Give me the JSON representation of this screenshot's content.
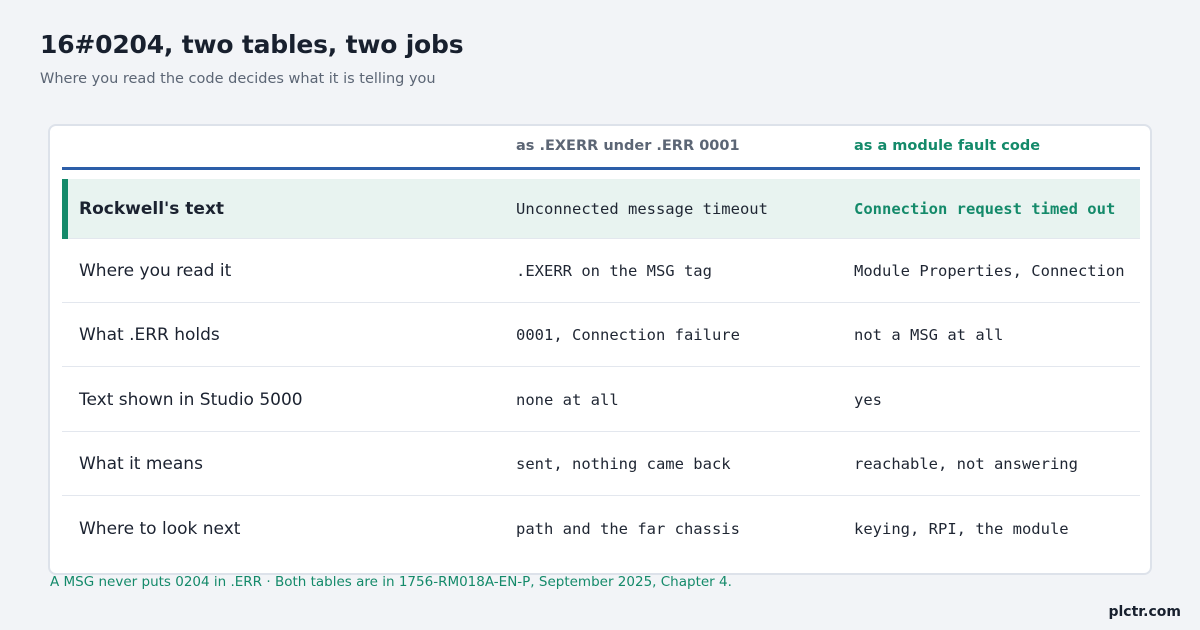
{
  "header": {
    "title": "16#0204, two tables, two jobs",
    "subtitle": "Where you read the code decides what it is telling you"
  },
  "table": {
    "columns": [
      "",
      "as .EXERR under .ERR 0001",
      "as a module fault code"
    ],
    "rows": [
      {
        "label": "Rockwell's text",
        "col1": "Unconnected message timeout",
        "col2": "Connection request timed out"
      },
      {
        "label": "Where you read it",
        "col1": ".EXERR on the MSG tag",
        "col2": "Module Properties, Connection"
      },
      {
        "label": "What .ERR holds",
        "col1": "0001, Connection failure",
        "col2": "not a MSG at all"
      },
      {
        "label": "Text shown in Studio 5000",
        "col1": "none at all",
        "col2": "yes"
      },
      {
        "label": "What it means",
        "col1": "sent, nothing came back",
        "col2": "reachable, not answering"
      },
      {
        "label": "Where to look next",
        "col1": "path and the far chassis",
        "col2": "keying, RPI, the module"
      }
    ]
  },
  "footnote": "A MSG never puts 0204 in .ERR · Both tables are in 1756-RM018A-EN-P, September 2025, Chapter 4.",
  "brand": "plctr.com",
  "colors": {
    "accent": "#148a6a",
    "rule": "#2c5ea8",
    "highlight_bg": "#e8f3f0"
  }
}
